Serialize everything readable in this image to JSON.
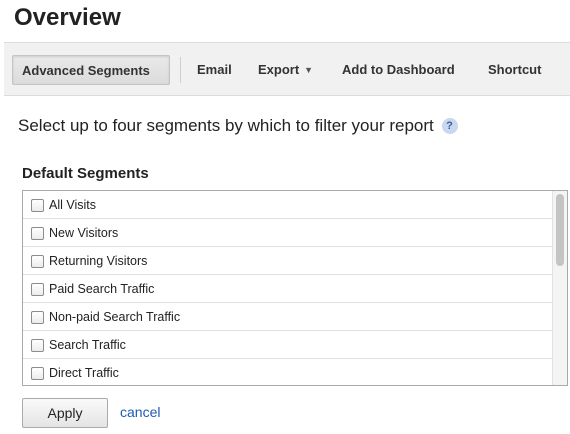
{
  "page": {
    "title": "Overview"
  },
  "toolbar": {
    "advanced_segments": "Advanced Segments",
    "email": "Email",
    "export": "Export",
    "export_caret": "▼",
    "add_to_dashboard": "Add to Dashboard",
    "shortcut": "Shortcut"
  },
  "instruction": {
    "text": "Select up to four segments by which to filter your report",
    "help_icon": "?"
  },
  "default_segments": {
    "heading": "Default Segments",
    "items": [
      {
        "label": "All Visits",
        "checked": false
      },
      {
        "label": "New Visitors",
        "checked": false
      },
      {
        "label": "Returning Visitors",
        "checked": false
      },
      {
        "label": "Paid Search Traffic",
        "checked": false
      },
      {
        "label": "Non-paid Search Traffic",
        "checked": false
      },
      {
        "label": "Search Traffic",
        "checked": false
      },
      {
        "label": "Direct Traffic",
        "checked": false
      }
    ]
  },
  "actions": {
    "apply": "Apply",
    "cancel": "cancel"
  },
  "colors": {
    "link": "#1f5ab4",
    "toolbar_bg": "#f1f1f1",
    "help_icon_bg": "#c9d8ee"
  }
}
